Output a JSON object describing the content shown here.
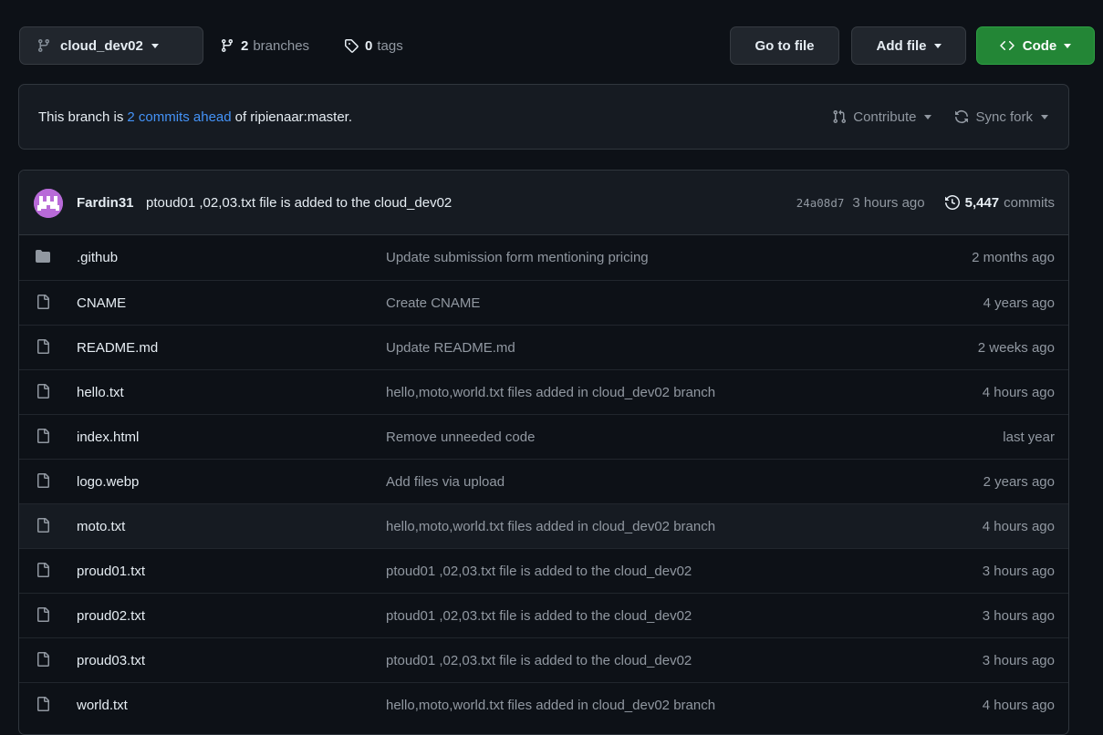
{
  "toolbar": {
    "branch_name": "cloud_dev02",
    "branches_count": "2",
    "branches_label": "branches",
    "tags_count": "0",
    "tags_label": "tags",
    "goto_file_label": "Go to file",
    "add_file_label": "Add file",
    "code_label": "Code"
  },
  "banner": {
    "prefix": "This branch is",
    "link": "2 commits ahead",
    "suffix": "of ripienaar:master.",
    "contribute_label": "Contribute",
    "sync_label": "Sync fork"
  },
  "commit": {
    "author": "Fardin31",
    "message": "ptoud01 ,02,03.txt file is added to the cloud_dev02",
    "sha": "24a08d7",
    "time": "3 hours ago",
    "count": "5,447",
    "count_label": "commits"
  },
  "files": [
    {
      "name": ".github",
      "message": "Update submission form mentioning pricing",
      "age": "2 months ago",
      "type": "dir"
    },
    {
      "name": "CNAME",
      "message": "Create CNAME",
      "age": "4 years ago",
      "type": "file"
    },
    {
      "name": "README.md",
      "message": "Update README.md",
      "age": "2 weeks ago",
      "type": "file"
    },
    {
      "name": "hello.txt",
      "message": "hello,moto,world.txt files added in cloud_dev02 branch",
      "age": "4 hours ago",
      "type": "file"
    },
    {
      "name": "index.html",
      "message": "Remove unneeded code",
      "age": "last year",
      "type": "file"
    },
    {
      "name": "logo.webp",
      "message": "Add files via upload",
      "age": "2 years ago",
      "type": "file"
    },
    {
      "name": "moto.txt",
      "message": "hello,moto,world.txt files added in cloud_dev02 branch",
      "age": "4 hours ago",
      "type": "file"
    },
    {
      "name": "proud01.txt",
      "message": "ptoud01 ,02,03.txt file is added to the cloud_dev02",
      "age": "3 hours ago",
      "type": "file"
    },
    {
      "name": "proud02.txt",
      "message": "ptoud01 ,02,03.txt file is added to the cloud_dev02",
      "age": "3 hours ago",
      "type": "file"
    },
    {
      "name": "proud03.txt",
      "message": "ptoud01 ,02,03.txt file is added to the cloud_dev02",
      "age": "3 hours ago",
      "type": "file"
    },
    {
      "name": "world.txt",
      "message": "hello,moto,world.txt files added in cloud_dev02 branch",
      "age": "4 hours ago",
      "type": "file"
    }
  ],
  "colors": {
    "background": "#0d1117",
    "panel": "#161b22",
    "border": "#30363d",
    "link": "#4493f8",
    "code_button": "#238636",
    "muted_text": "#9198a1"
  },
  "icons": {
    "branch": "git-branch-icon",
    "tag": "tag-icon",
    "code": "code-brackets-icon",
    "pull_request": "git-pull-request-icon",
    "sync": "sync-icon",
    "history": "history-clock-icon",
    "folder": "folder-icon",
    "file": "file-icon"
  }
}
